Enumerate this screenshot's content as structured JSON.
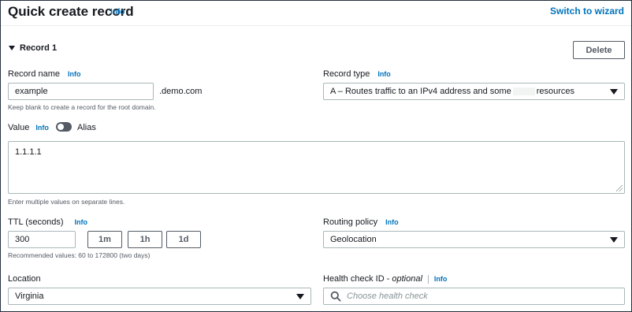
{
  "header": {
    "title": "Quick create record",
    "info": "Info",
    "switch_link": "Switch to wizard"
  },
  "record": {
    "heading": "Record 1",
    "delete_label": "Delete"
  },
  "record_name": {
    "label": "Record name",
    "info": "Info",
    "value": "example",
    "suffix": ".demo.com",
    "hint": "Keep blank to create a record for the root domain."
  },
  "record_type": {
    "label": "Record type",
    "info": "Info",
    "value_part1": "A – Routes traffic to an IPv4 address and some",
    "value_part2": "resources"
  },
  "value": {
    "label": "Value",
    "info": "Info",
    "alias_label": "Alias",
    "alias_enabled": false,
    "content": "1.1.1.1",
    "hint": "Enter multiple values on separate lines."
  },
  "ttl": {
    "label": "TTL (seconds)",
    "info": "Info",
    "value": "300",
    "buttons": [
      "1m",
      "1h",
      "1d"
    ],
    "hint": "Recommended values: 60 to 172800 (two days)"
  },
  "routing_policy": {
    "label": "Routing policy",
    "info": "Info",
    "value": "Geolocation"
  },
  "location": {
    "label": "Location",
    "value": "Virginia"
  },
  "health_check": {
    "label_main": "Health check ID - ",
    "label_optional": "optional",
    "info": "Info",
    "placeholder": "Choose health check"
  },
  "colors": {
    "link": "#0073bb",
    "text": "#16191f",
    "border": "#aab7b8"
  }
}
